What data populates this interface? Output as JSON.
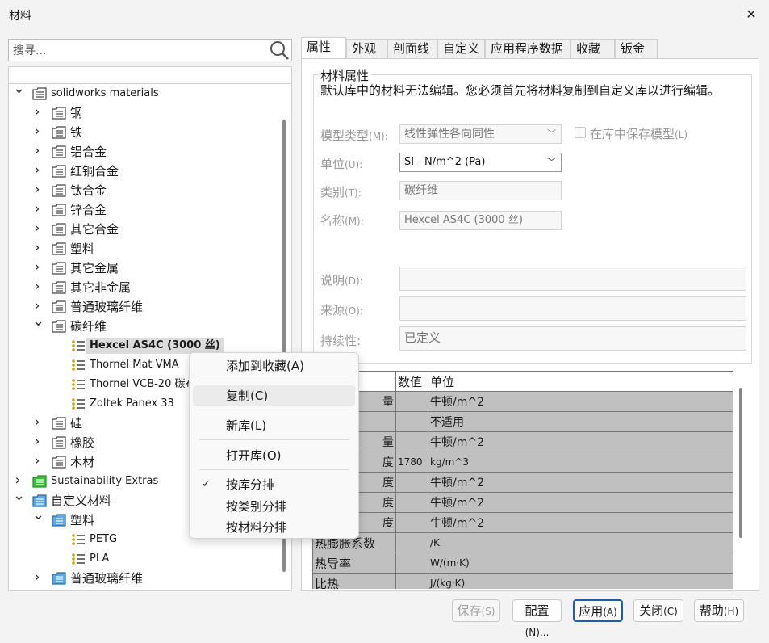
{
  "window": {
    "title": "材料",
    "close_icon": "close-icon"
  },
  "search": {
    "placeholder": "搜寻..."
  },
  "tree": [
    {
      "label": "solidworks materials",
      "expanded": true,
      "icon": "library-icon"
    },
    {
      "label": "钢"
    },
    {
      "label": "铁"
    },
    {
      "label": "铝合金"
    },
    {
      "label": "红铜合金"
    },
    {
      "label": "钛合金"
    },
    {
      "label": "锌合金"
    },
    {
      "label": "其它合金"
    },
    {
      "label": "塑料"
    },
    {
      "label": "其它金属"
    },
    {
      "label": "其它非金属"
    },
    {
      "label": "普通玻璃纤维"
    },
    {
      "label": "碳纤维",
      "expanded": true
    },
    {
      "label": "Hexcel AS4C (3000 丝)",
      "selected": true
    },
    {
      "label": "Thornel Mat VMA"
    },
    {
      "label": "Thornel VCB-20 碳布"
    },
    {
      "label": "Zoltek Panex 33"
    },
    {
      "label": "硅"
    },
    {
      "label": "橡胶"
    },
    {
      "label": "木材"
    },
    {
      "label": "Sustainability Extras"
    },
    {
      "label": "自定义材料",
      "expanded": true
    },
    {
      "label": "塑料",
      "expanded": true
    },
    {
      "label": "PETG"
    },
    {
      "label": "PLA"
    },
    {
      "label": "普通玻璃纤维"
    }
  ],
  "tabs": [
    "属性",
    "外观",
    "剖面线",
    "自定义",
    "应用程序数据",
    "收藏",
    "钣金"
  ],
  "properties": {
    "group_title": "材料属性",
    "notice": "默认库中的材料无法编辑。您必须首先将材料复制到自定义库以进行编辑。",
    "model_type_label": "模型类型",
    "model_type_key": "(M):",
    "model_type_value": "线性弹性各向同性",
    "save_model_label": "在库中保存模型",
    "save_model_key": "(L)",
    "unit_label": "单位",
    "unit_key": "(U):",
    "unit_value": "SI - N/m^2 (Pa)",
    "category_label": "类别",
    "category_key": "(T):",
    "category_value": "碳纤维",
    "name_label": "名称",
    "name_key": "(M):",
    "name_value": "Hexcel AS4C (3000 丝)",
    "desc_label": "说明",
    "desc_key": "(D):",
    "source_label": "来源",
    "source_key": "(O):",
    "sustain_label": "持续性:",
    "sustain_value": "已定义"
  },
  "table": {
    "headers": [
      "",
      "数值",
      "单位"
    ],
    "rows": [
      [
        "量",
        "",
        "牛顿/m^2"
      ],
      [
        "",
        "",
        "不适用"
      ],
      [
        "量",
        "",
        "牛顿/m^2"
      ],
      [
        "度",
        "1780",
        "kg/m^3"
      ],
      [
        "度",
        "",
        "牛顿/m^2"
      ],
      [
        "度",
        "",
        "牛顿/m^2"
      ],
      [
        "度",
        "",
        "牛顿/m^2"
      ],
      [
        "热膨胀系数",
        "",
        "/K"
      ],
      [
        "热导率",
        "",
        "W/(m·K)"
      ],
      [
        "比热",
        "",
        "J/(kg·K)"
      ]
    ]
  },
  "context_menu": {
    "add_favorite": "添加到收藏(A)",
    "copy": "复制(C)",
    "new_library": "新库(L)",
    "open_library": "打开库(O)",
    "sort_by_library": "按库分排",
    "sort_by_category": "按类别分排",
    "sort_by_material": "按材料分排"
  },
  "buttons": {
    "save": "保存",
    "save_key": "(S)",
    "config": "配置",
    "config_key": "(N)...",
    "apply": "应用",
    "apply_key": "(A)",
    "close": "关闭",
    "close_key": "(C)",
    "help": "帮助",
    "help_key": "(H)"
  }
}
